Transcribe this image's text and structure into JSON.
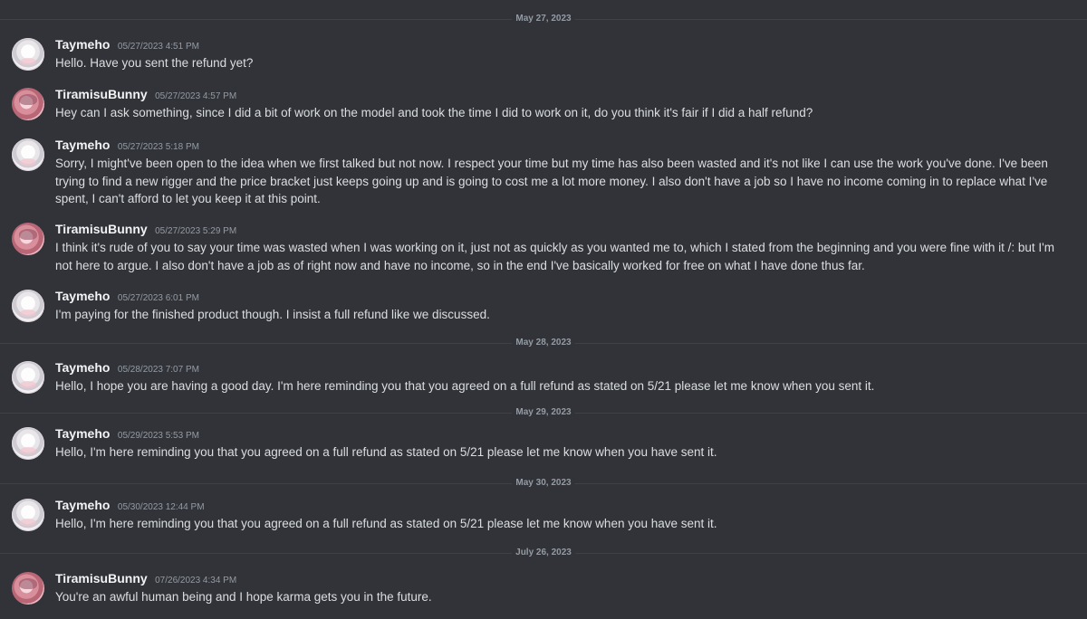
{
  "date_dividers": [
    "May 27, 2023",
    "May 28, 2023",
    "May 29, 2023",
    "May 30, 2023",
    "July 26, 2023"
  ],
  "messages": [
    {
      "username": "Taymeho",
      "timestamp": "05/27/2023 4:51 PM",
      "text": "Hello. Have you sent the refund yet?",
      "avatar": "taymeho-avatar"
    },
    {
      "username": "TiramisuBunny",
      "timestamp": "05/27/2023 4:57 PM",
      "text": "Hey can I ask something, since I did a bit of work on the model and took the time I did to work on it, do you think it's fair if I did a half refund?",
      "avatar": "tiramisubunny-avatar"
    },
    {
      "username": "Taymeho",
      "timestamp": "05/27/2023 5:18 PM",
      "text": "Sorry, I might've been open to the idea when we first talked but not now. I respect your time but my time has also been wasted and it's not like I can use the work you've done. I've been trying to find a new rigger and the price bracket just keeps going up and is going to cost me a lot more money. I also don't have a job so I have no income coming in to replace what I've spent, I can't afford to let you keep it at this point.",
      "avatar": "taymeho-avatar"
    },
    {
      "username": "TiramisuBunny",
      "timestamp": "05/27/2023 5:29 PM",
      "text": "I think it's rude of you to say your time was wasted when I was working on it, just not as quickly as you wanted me to, which I stated from the beginning and you were fine with it /: but I'm not here to argue. I also don't have a job as of right now and have no income, so in the end I've basically worked for free on what I have done thus far.",
      "avatar": "tiramisubunny-avatar"
    },
    {
      "username": "Taymeho",
      "timestamp": "05/27/2023 6:01 PM",
      "text": "I'm paying for the finished product though. I insist a full refund like we discussed.",
      "avatar": "taymeho-avatar"
    },
    {
      "username": "Taymeho",
      "timestamp": "05/28/2023 7:07 PM",
      "text": "Hello, I hope you are having a good day.  I'm here reminding you that you agreed on a full refund as stated on 5/21 please let me know when you sent it.",
      "avatar": "taymeho-avatar"
    },
    {
      "username": "Taymeho",
      "timestamp": "05/29/2023 5:53 PM",
      "text": "Hello, I'm here reminding you that you agreed on a full refund as stated on 5/21 please let me know when you have sent it.",
      "avatar": "taymeho-avatar"
    },
    {
      "username": "Taymeho",
      "timestamp": "05/30/2023 12:44 PM",
      "text": "Hello, I'm here reminding you that you agreed on a full refund as stated on 5/21 please let me know when you have sent it.",
      "avatar": "taymeho-avatar"
    },
    {
      "username": "TiramisuBunny",
      "timestamp": "07/26/2023 4:34 PM",
      "text": "You're an awful human being and I hope karma gets you in the future.",
      "avatar": "tiramisubunny-avatar"
    }
  ],
  "colors": {
    "background": "#313338",
    "username": "#f2f3f5",
    "message_text": "#dbdee1",
    "muted_text": "#949ba4",
    "divider_line": "#3f4147"
  }
}
